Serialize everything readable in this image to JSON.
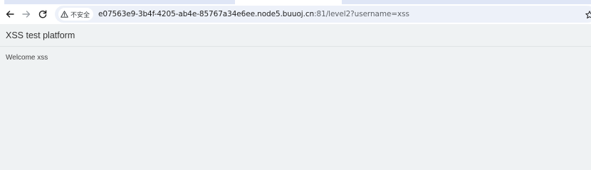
{
  "browser": {
    "security_chip_label": "不安全",
    "url_host": "e07563e9-3b4f-4205-ab4e-85767a34e6ee.node5.buuoj.cn",
    "url_rest": ":81/level2?username=xss",
    "colors": {
      "tabstrip": "#dfe6f6",
      "toolbar": "#ffffff",
      "omnibox": "#edf1f9"
    }
  },
  "page": {
    "brand": "XSS test platform",
    "welcome_text": "Welcome xss",
    "background": "#eff2f3"
  }
}
